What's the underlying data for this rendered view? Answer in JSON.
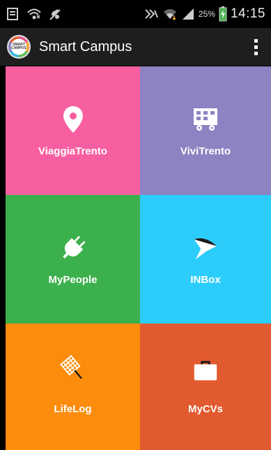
{
  "status_bar": {
    "battery_percent": "25%",
    "time": "14:15",
    "icons": [
      "sim-icon",
      "wifi-icon",
      "mute-icon",
      "nfc-icon",
      "wifi-signal-icon",
      "cell-signal-icon",
      "battery-charging-icon"
    ]
  },
  "app_bar": {
    "logo_text": "SMART CAMPUS",
    "title": "Smart Campus",
    "overflow_icon": "overflow-menu-icon"
  },
  "tiles": [
    {
      "label": "ViaggiaTrento",
      "icon": "location-pin-icon",
      "color": "#f75fa0"
    },
    {
      "label": "ViviTrento",
      "icon": "bus-icon",
      "color": "#8c83c2"
    },
    {
      "label": "MyPeople",
      "icon": "plug-icon",
      "color": "#3cb04c"
    },
    {
      "label": "INBox",
      "icon": "funnel-icon",
      "color": "#2ccdfa"
    },
    {
      "label": "LifeLog",
      "icon": "net-icon",
      "color": "#fb8c0c"
    },
    {
      "label": "MyCVs",
      "icon": "briefcase-icon",
      "color": "#e25a2f"
    }
  ]
}
